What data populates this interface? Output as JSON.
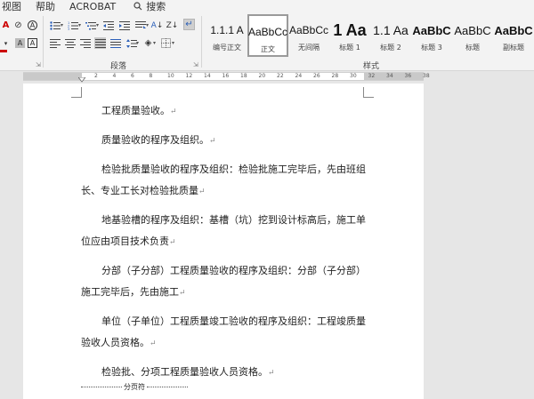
{
  "menu": {
    "items": [
      "视图",
      "帮助",
      "ACROBAT"
    ],
    "search_label": "搜索"
  },
  "ribbon": {
    "paragraph_group_label": "段落",
    "styles_group_label": "样式",
    "styles": [
      {
        "preview": "1.1.1 A",
        "name": "编号正文",
        "size": 12
      },
      {
        "preview": "AaBbCc",
        "name": "正文",
        "size": 12,
        "selected": true
      },
      {
        "preview": "AaBbCc",
        "name": "无间隔",
        "size": 12
      },
      {
        "preview": "1 Aa",
        "name": "标题 1",
        "size": 18,
        "bold": true
      },
      {
        "preview": "1.1 Aa",
        "name": "标题 2",
        "size": 14
      },
      {
        "preview": "AaBbC",
        "name": "标题 3",
        "size": 13,
        "bold": true
      },
      {
        "preview": "AaBbC",
        "name": "标题",
        "size": 13
      },
      {
        "preview": "AaBbC",
        "name": "副标题",
        "size": 13,
        "bold": true
      }
    ]
  },
  "ruler": {
    "ticks": [
      "2",
      "4",
      "6",
      "8",
      "10",
      "12",
      "14",
      "16",
      "18",
      "20",
      "22",
      "24",
      "26",
      "28",
      "30",
      "32",
      "34",
      "36",
      "38"
    ]
  },
  "document": {
    "paragraphs": [
      "工程质量验收。",
      "质量验收的程序及组织。",
      "检验批质量验收的程序及组织：检验批施工完毕后，先由班组长、专业工长对检验批质量",
      "地基验槽的程序及组织：基槽（坑）挖到设计标高后，施工单位应由项目技术负责",
      "分部（子分部）工程质量验收的程序及组织：分部（子分部）施工完毕后，先由施工",
      "单位（子单位）工程质量竣工验收的程序及组织：工程竣质量验收人员资格。",
      "检验批、分项工程质量验收人员资格。"
    ],
    "paragraph_mark": "↵",
    "page_break_label": "分页符"
  }
}
